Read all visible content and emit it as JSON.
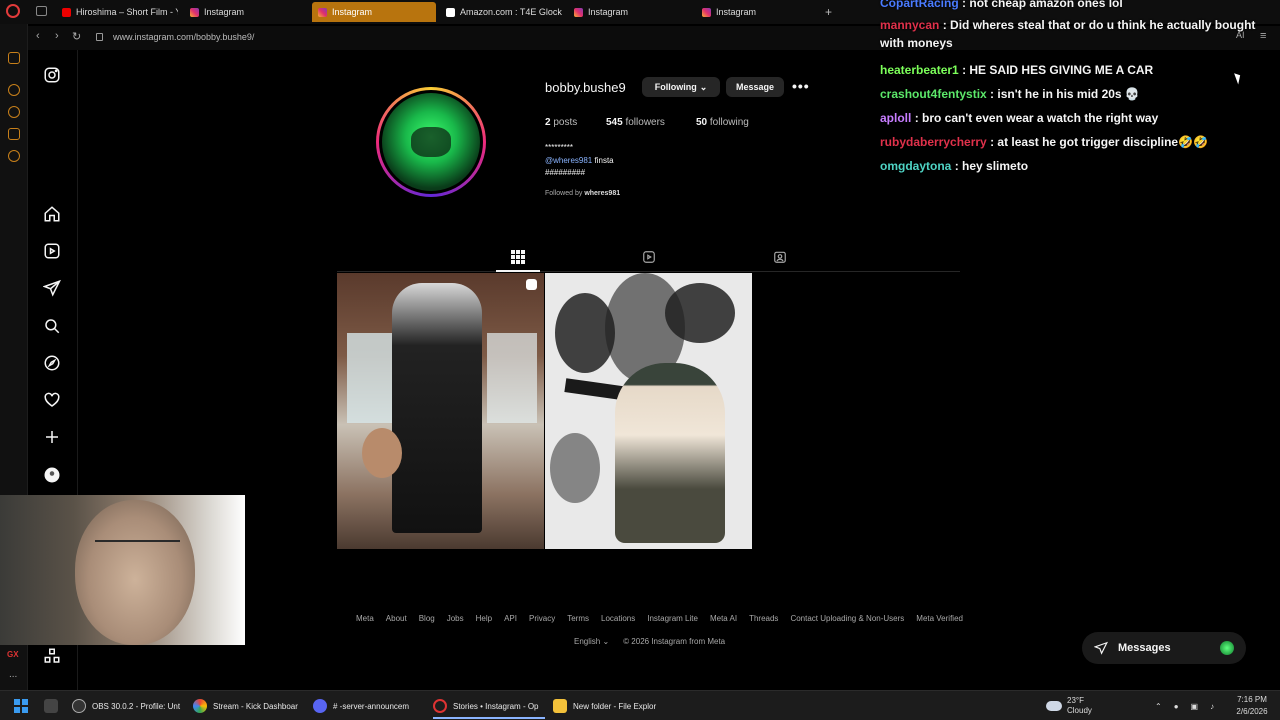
{
  "browser": {
    "tabs": [
      {
        "label": "Hiroshima – Short Film - Y",
        "favicon": "youtube-icon"
      },
      {
        "label": "Instagram",
        "favicon": "instagram-icon"
      },
      {
        "label": "Instagram",
        "favicon": "instagram-icon",
        "active": true
      },
      {
        "label": "Amazon.com : T4E Glock",
        "favicon": "amazon-icon"
      },
      {
        "label": "Instagram",
        "favicon": "instagram-icon"
      },
      {
        "label": "Instagram",
        "favicon": "instagram-icon"
      }
    ],
    "new_tab": "+",
    "url": "www.instagram.com/bobby.bushe9/",
    "ai_label": "AI",
    "accent": "#b8740e"
  },
  "sidebar_strip": {
    "gx_label": "GX",
    "more": "..."
  },
  "profile": {
    "username": "bobby.bushe9",
    "following_label": "Following",
    "message_label": "Message",
    "more": "•••",
    "posts_count": "2",
    "posts_label": "posts",
    "followers_count": "545",
    "followers_label": "followers",
    "following_count": "50",
    "following_label2": "following",
    "bio_name": "*********",
    "bio_link": "@wheres981",
    "bio_link_suffix": "finsta",
    "bio_hashes": "#########",
    "followed_by_prefix": "Followed by",
    "followed_by_user": "wheres981"
  },
  "footer": {
    "links": [
      "Meta",
      "About",
      "Blog",
      "Jobs",
      "Help",
      "API",
      "Privacy",
      "Terms",
      "Locations",
      "Instagram Lite",
      "Meta AI",
      "Threads",
      "Contact Uploading & Non-Users",
      "Meta Verified"
    ],
    "language": "English",
    "copyright": "© 2026 Instagram from Meta"
  },
  "messages_pill": {
    "label": "Messages"
  },
  "chat": [
    {
      "user": "CopartRacing",
      "color": "#4a7bff",
      "text": ": not cheap amazon ones lol"
    },
    {
      "user": "mannycan",
      "color": "#e0314b",
      "text": ": Did wheres steal that or do u think he actually bought with moneys"
    },
    {
      "user": "heaterbeater1",
      "color": "#7cff5a",
      "text": ": HE SAID HES GIVING ME A CAR"
    },
    {
      "user": "crashout4fentystix",
      "color": "#5ce86a",
      "text": ": isn't he in his mid 20s 💀"
    },
    {
      "user": "aploll",
      "color": "#c77dff",
      "text": ": bro can't even wear a watch the right way"
    },
    {
      "user": "rubydaberrycherry",
      "color": "#e0314b",
      "text": ": at least he got trigger discipline🤣🤣"
    },
    {
      "user": "omgdaytona",
      "color": "#4fd3c4",
      "text": ": hey slimeto"
    }
  ],
  "taskbar": {
    "items": [
      {
        "label": "OBS 30.0.2 - Profile: Unt",
        "icon": "obs-icon"
      },
      {
        "label": "Stream - Kick Dashboar",
        "icon": "chrome-icon"
      },
      {
        "label": "# -server-announcem",
        "icon": "discord-icon"
      },
      {
        "label": "Stories • Instagram - Op",
        "icon": "opera-icon"
      },
      {
        "label": "New folder - File Explor",
        "icon": "folder-icon"
      }
    ],
    "weather_temp": "23°F",
    "weather_desc": "Cloudy",
    "time": "7:16 PM",
    "date": "2/6/2026"
  }
}
